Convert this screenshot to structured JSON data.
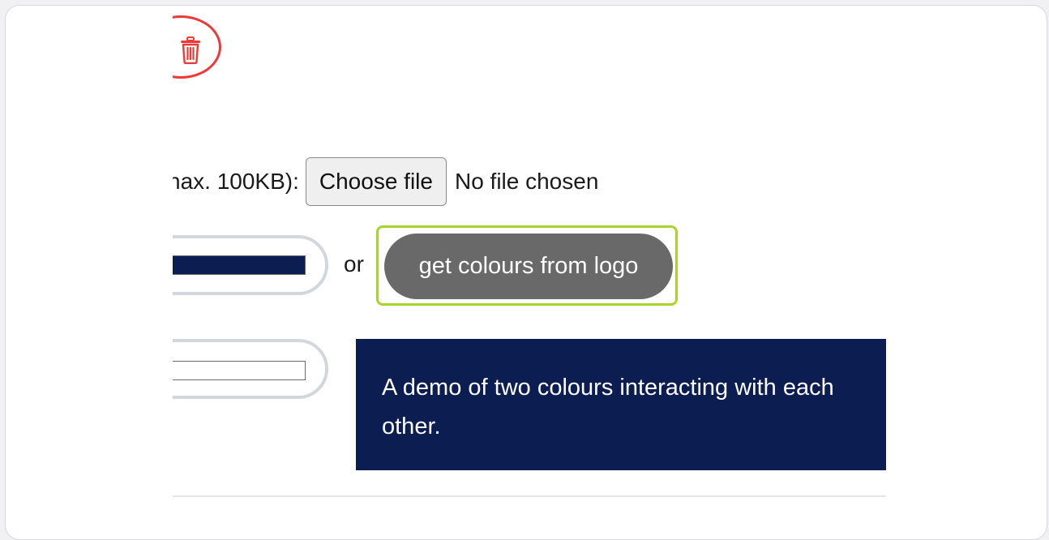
{
  "file_upload": {
    "label": "nax. 100KB):",
    "button_label": "Choose file",
    "status": "No file chosen"
  },
  "colors": {
    "primary": "#0b1d51",
    "secondary": "#ffffff",
    "delete_accent": "#ee3a36",
    "focus_outline": "#a6d52c",
    "logo_button_bg": "#696969"
  },
  "actions": {
    "or_text": "or",
    "get_colours_label": "get colours from logo",
    "delete_icon": "trash-icon"
  },
  "demo": {
    "text": "A demo of two colours interacting with each other."
  }
}
